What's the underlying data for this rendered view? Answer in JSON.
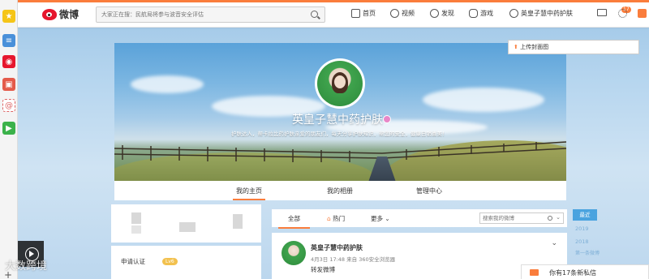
{
  "topbar": {
    "logo_text": "微博",
    "search_placeholder": "大家正在搜：民航局将参与波音安全评估",
    "nav": {
      "home": "首页",
      "video": "视频",
      "discover": "发现",
      "game": "游戏",
      "user": "英皇子慧中药护肤"
    },
    "message_badge": "17"
  },
  "cover": {
    "upload_label": "上传封面图",
    "name": "英皇子慧中药护肤",
    "description": "护肤达人，帮卡拉比药护肤亲爱的朋友们，每天分享护肤知识，帮您的安全，健康日销喜美！"
  },
  "profile_tabs": [
    "我的主页",
    "我的相册",
    "管理中心"
  ],
  "left": {
    "cert_label": "申请认证",
    "level_badge": "Lv6"
  },
  "feed": {
    "tabs": [
      "全部",
      "热门",
      "更多"
    ],
    "search_placeholder": "搜索我的微博",
    "post": {
      "name": "英皇子慧中药护肤",
      "meta": "4月3日 17:48 来自 360安全浏览器",
      "text": "转发微博"
    }
  },
  "timeline": {
    "recent": "最近",
    "years": [
      "2019",
      "2018"
    ],
    "more": "第一条微博"
  },
  "notify": {
    "text": "你有17条新私信"
  },
  "watermark": "大数跨境",
  "colors": {
    "accent": "#fa7d3c",
    "weibo_red": "#e6162d",
    "timeline_blue": "#4aa3df"
  }
}
